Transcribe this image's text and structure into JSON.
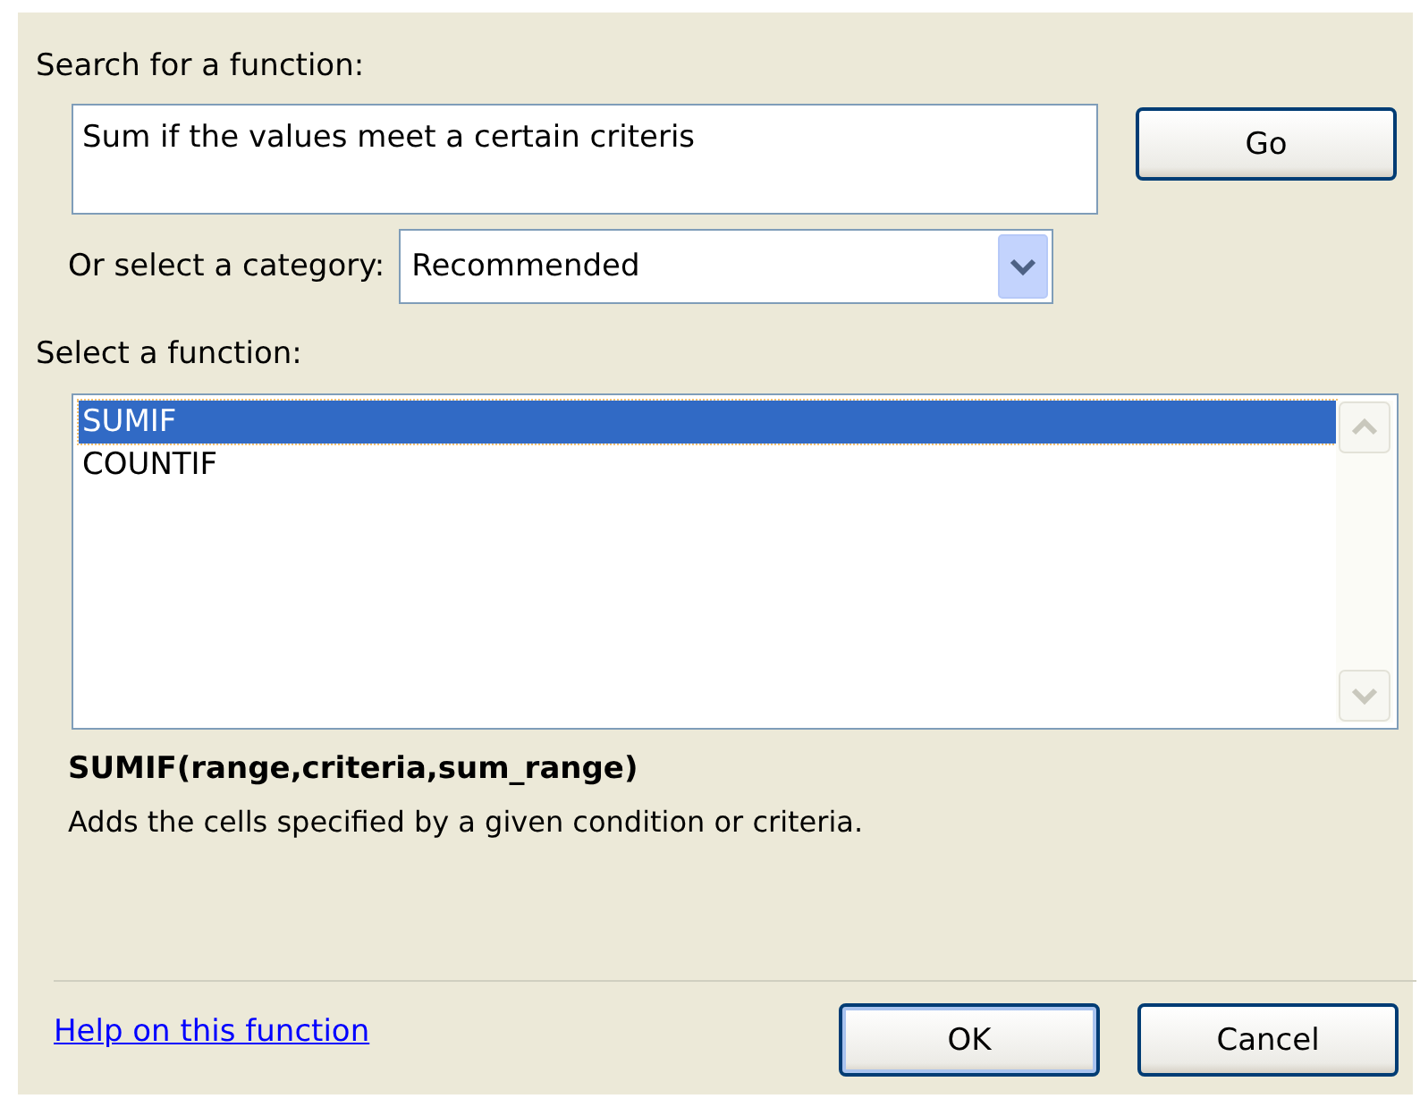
{
  "search": {
    "label": "Search for a function:",
    "value": "Sum if the values meet a certain criteris"
  },
  "go_button": {
    "label": "Go"
  },
  "category": {
    "label": "Or select a category:",
    "value": "Recommended"
  },
  "function_list": {
    "label": "Select a function:",
    "items": [
      {
        "name": "SUMIF",
        "selected": true
      },
      {
        "name": "COUNTIF",
        "selected": false
      }
    ]
  },
  "signature": "SUMIF(range,criteria,sum_range)",
  "description": "Adds the cells specified by a given condition or criteria.",
  "help_link": "Help on this function",
  "buttons": [
    {
      "label": "OK",
      "default": true
    },
    {
      "label": "Cancel",
      "default": false
    }
  ]
}
